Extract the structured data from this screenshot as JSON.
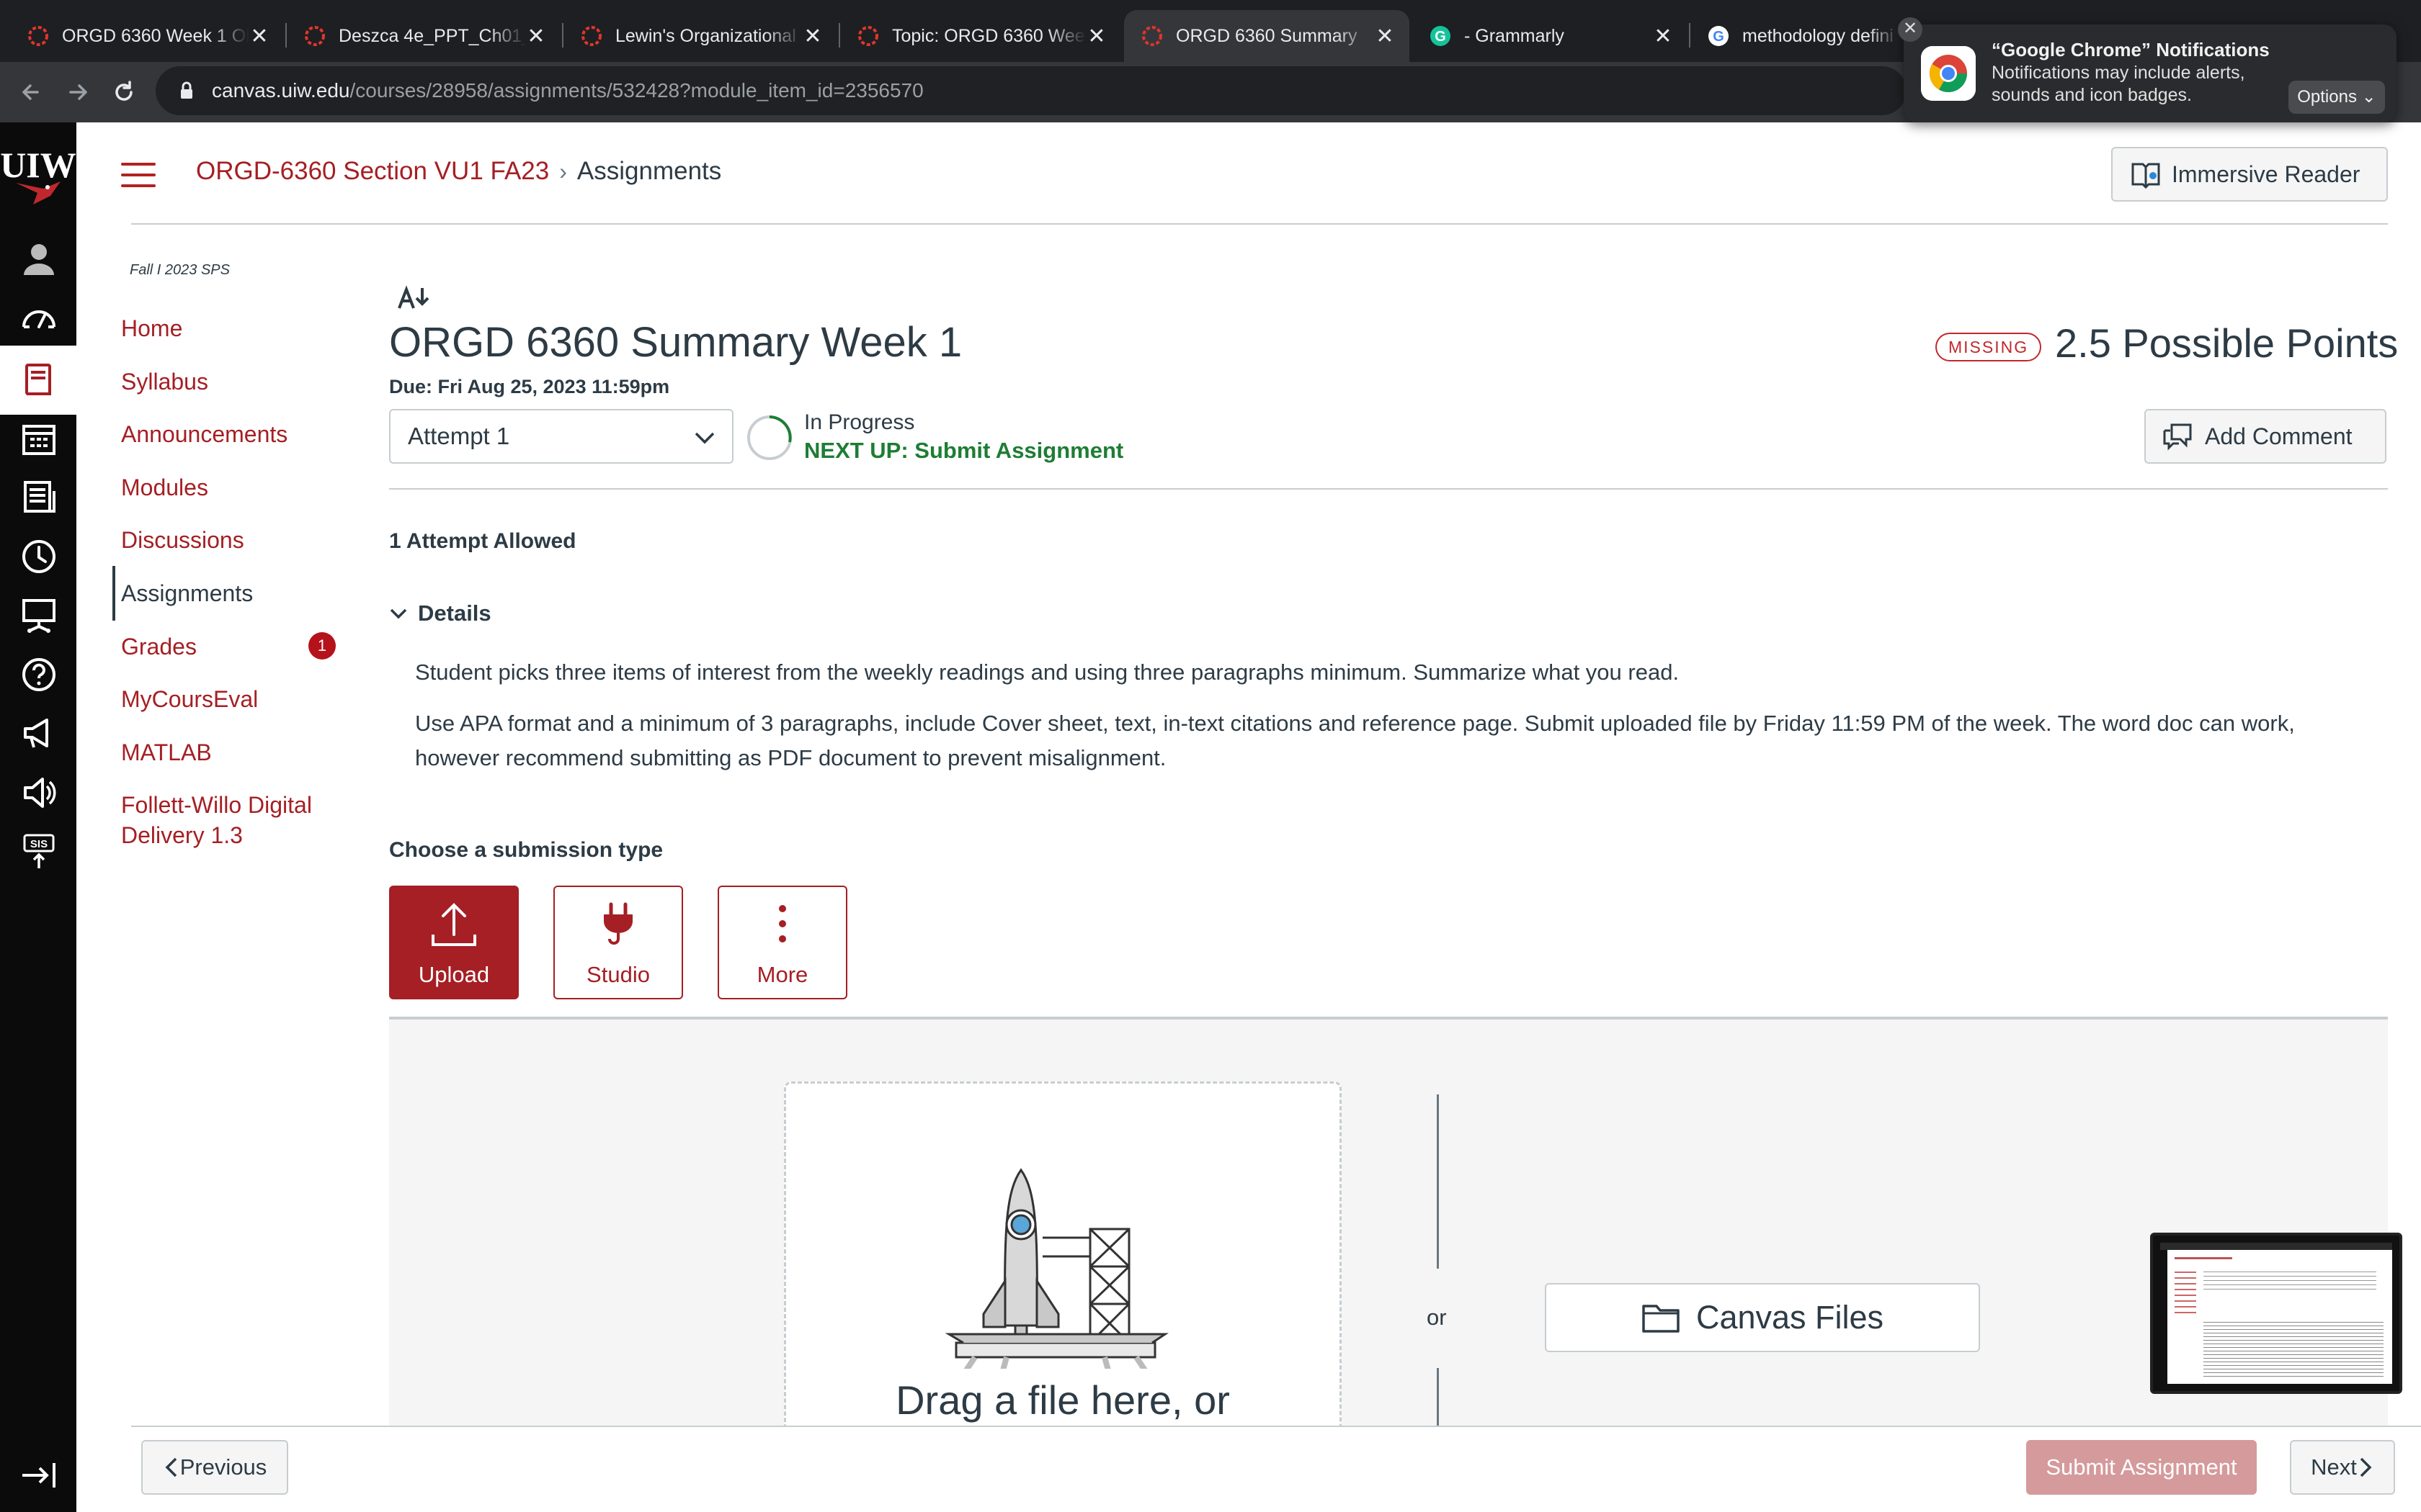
{
  "browser": {
    "tabs": [
      {
        "title": "ORGD 6360 Week 1 Ob",
        "icon": "canvas-icon",
        "active": false
      },
      {
        "title": "Deszca 4e_PPT_Ch01_",
        "icon": "canvas-icon",
        "active": false
      },
      {
        "title": "Lewin's Organizational",
        "icon": "canvas-icon",
        "active": false
      },
      {
        "title": "Topic: ORGD 6360 Wee",
        "icon": "canvas-icon",
        "active": false
      },
      {
        "title": "ORGD 6360 Summary",
        "icon": "canvas-icon",
        "active": true
      },
      {
        "title": "- Grammarly",
        "icon": "grammarly-icon",
        "active": false
      },
      {
        "title": "methodology defini",
        "icon": "google-icon",
        "active": false
      }
    ],
    "tab_close": "✕",
    "url_host": "canvas.uiw.edu",
    "url_path": "/courses/28958/assignments/532428?module_item_id=2356570"
  },
  "notification": {
    "title": "“Google Chrome” Notifications",
    "body": "Notifications may include alerts, sounds and icon badges.",
    "options": "Options ⌄",
    "close": "✕"
  },
  "header": {
    "course": "ORGD-6360 Section VU1 FA23",
    "separator": "›",
    "page": "Assignments",
    "immersive_reader": "Immersive Reader"
  },
  "course_nav": {
    "term": "Fall I 2023 SPS",
    "items": [
      {
        "label": "Home"
      },
      {
        "label": "Syllabus"
      },
      {
        "label": "Announcements"
      },
      {
        "label": "Modules"
      },
      {
        "label": "Discussions"
      },
      {
        "label": "Assignments"
      },
      {
        "label": "Grades"
      },
      {
        "label": "MyCoursEval"
      },
      {
        "label": "MATLAB"
      },
      {
        "label": "Follett-Willo Digital"
      },
      {
        "label": "Delivery 1.3"
      }
    ],
    "grades_badge": "1"
  },
  "assignment": {
    "title": "ORGD 6360 Summary Week 1",
    "due": "Due: Fri Aug 25, 2023 11:59pm",
    "missing": "MISSING",
    "points": "2.5 Possible Points",
    "attempt": "Attempt 1",
    "status": "In Progress",
    "next_up": "NEXT UP: Submit Assignment",
    "add_comment": "Add Comment",
    "attempts_allowed": "1 Attempt Allowed",
    "details_label": "Details",
    "paragraph1": "Student picks three items of interest from the weekly readings and using three paragraphs minimum. Summarize what you read.",
    "paragraph2a": "Use APA format and a minimum of 3 paragraphs, include Cover sheet, text, in-text citations and reference page. Submit uploaded file by Friday 11:59 PM of the week. The word doc can work,",
    "paragraph2b": "however recommend submitting as PDF document to prevent misalignment.",
    "choose_type": "Choose a submission type",
    "types": [
      {
        "label": "Upload",
        "icon": "upload-icon",
        "selected": true
      },
      {
        "label": "Studio",
        "icon": "plug-icon",
        "selected": false
      },
      {
        "label": "More",
        "icon": "more-vertical-icon",
        "selected": false
      }
    ],
    "drag_text": "Drag a file here, or",
    "or": "or",
    "canvas_files": "Canvas Files"
  },
  "footer": {
    "previous": "Previous",
    "submit": "Submit Assignment",
    "next": "Next"
  },
  "colors": {
    "brand": "#a51f24",
    "link": "#a51f24",
    "success": "#1e7d34",
    "submit_disabled": "#d59a9c"
  }
}
